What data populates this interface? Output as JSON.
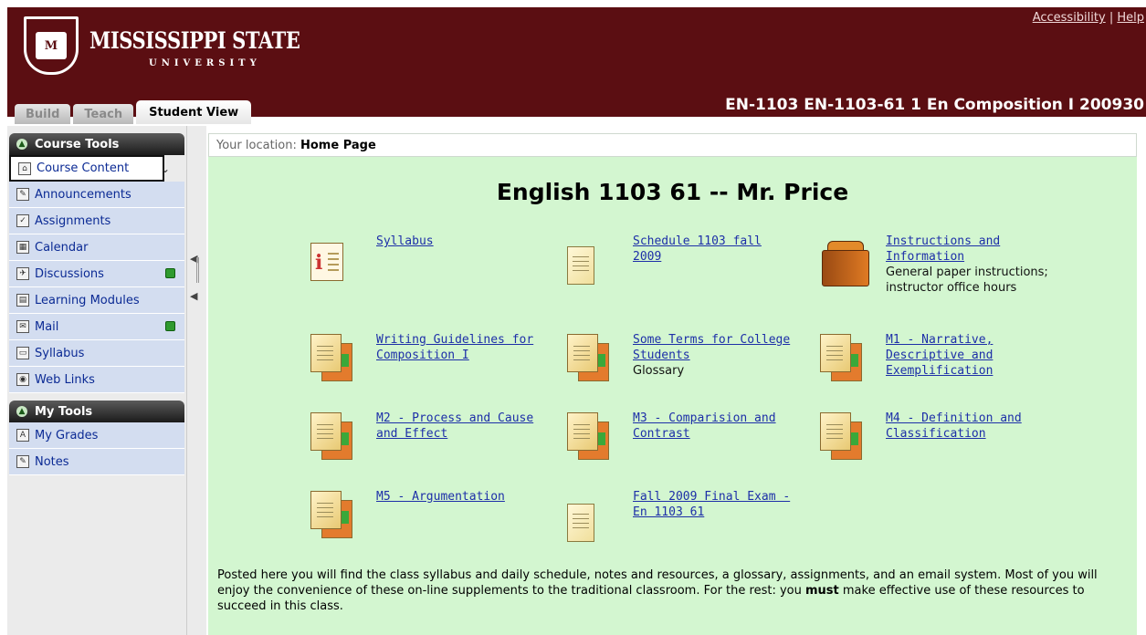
{
  "header": {
    "brand_title": "MISSISSIPPI STATE",
    "brand_sub": "UNIVERSITY",
    "logo_text": "M",
    "links": [
      "Accessibility",
      "Help"
    ],
    "link_separator": "|",
    "course_title": "EN-1103 EN-1103-61 1 En Composition I 200930"
  },
  "tabs": [
    {
      "label": "Build"
    },
    {
      "label": "Teach"
    },
    {
      "label": "Student View"
    }
  ],
  "sidebar": {
    "course_tools": {
      "heading": "Course Tools",
      "items": [
        {
          "label": "Course Content",
          "icon": "home-icon",
          "badge": false
        },
        {
          "label": "Announcements",
          "icon": "announcement-icon",
          "badge": false
        },
        {
          "label": "Assignments",
          "icon": "assignment-icon",
          "badge": false
        },
        {
          "label": "Calendar",
          "icon": "calendar-icon",
          "badge": false
        },
        {
          "label": "Discussions",
          "icon": "discussion-icon",
          "badge": true
        },
        {
          "label": "Learning Modules",
          "icon": "module-icon",
          "badge": false
        },
        {
          "label": "Mail",
          "icon": "mail-icon",
          "badge": true
        },
        {
          "label": "Syllabus",
          "icon": "syllabus-icon",
          "badge": false
        },
        {
          "label": "Web Links",
          "icon": "globe-icon",
          "badge": false
        }
      ]
    },
    "my_tools": {
      "heading": "My Tools",
      "items": [
        {
          "label": "My Grades",
          "icon": "grades-icon"
        },
        {
          "label": "Notes",
          "icon": "notes-icon"
        }
      ]
    }
  },
  "content": {
    "breadcrumb_prefix": "Your location:",
    "breadcrumb_current": "Home Page",
    "title": "English 1103 61 --  Mr. Price",
    "items": [
      {
        "title": "Syllabus",
        "desc": "",
        "icon": "syllabus-file-icon"
      },
      {
        "title": "Schedule 1103 fall 2009",
        "desc": "",
        "icon": "document-icon"
      },
      {
        "title": "Instructions and Information",
        "desc": "General paper instructions; instructor office hours",
        "icon": "briefcase-icon"
      },
      {
        "title": "Writing Guidelines for Composition I",
        "desc": "",
        "icon": "folder-stack-icon"
      },
      {
        "title": "Some Terms for College Students",
        "desc": "Glossary",
        "icon": "folder-stack-icon"
      },
      {
        "title": "M1 - Narrative, Descriptive and Exemplification",
        "desc": "",
        "icon": "folder-stack-icon"
      },
      {
        "title": "M2 - Process and Cause and Effect",
        "desc": "",
        "icon": "folder-stack-icon"
      },
      {
        "title": "M3 - Comparision and Contrast",
        "desc": "",
        "icon": "folder-stack-icon"
      },
      {
        "title": "M4 - Definition and Classification",
        "desc": "",
        "icon": "folder-stack-icon"
      },
      {
        "title": "M5 - Argumentation",
        "desc": "",
        "icon": "folder-stack-icon"
      },
      {
        "title": "Fall 2009 Final Exam - En 1103 61",
        "desc": "",
        "icon": "document-icon"
      }
    ],
    "intro_start": "Posted here you will find the class syllabus and daily schedule, notes and resources, a glossary, assignments, and an email system. Most of you will enjoy the convenience of these on-line supplements to the traditional classroom. For the rest: you ",
    "intro_bold": "must",
    "intro_end": " make effective use of these resources to succeed in this class."
  }
}
